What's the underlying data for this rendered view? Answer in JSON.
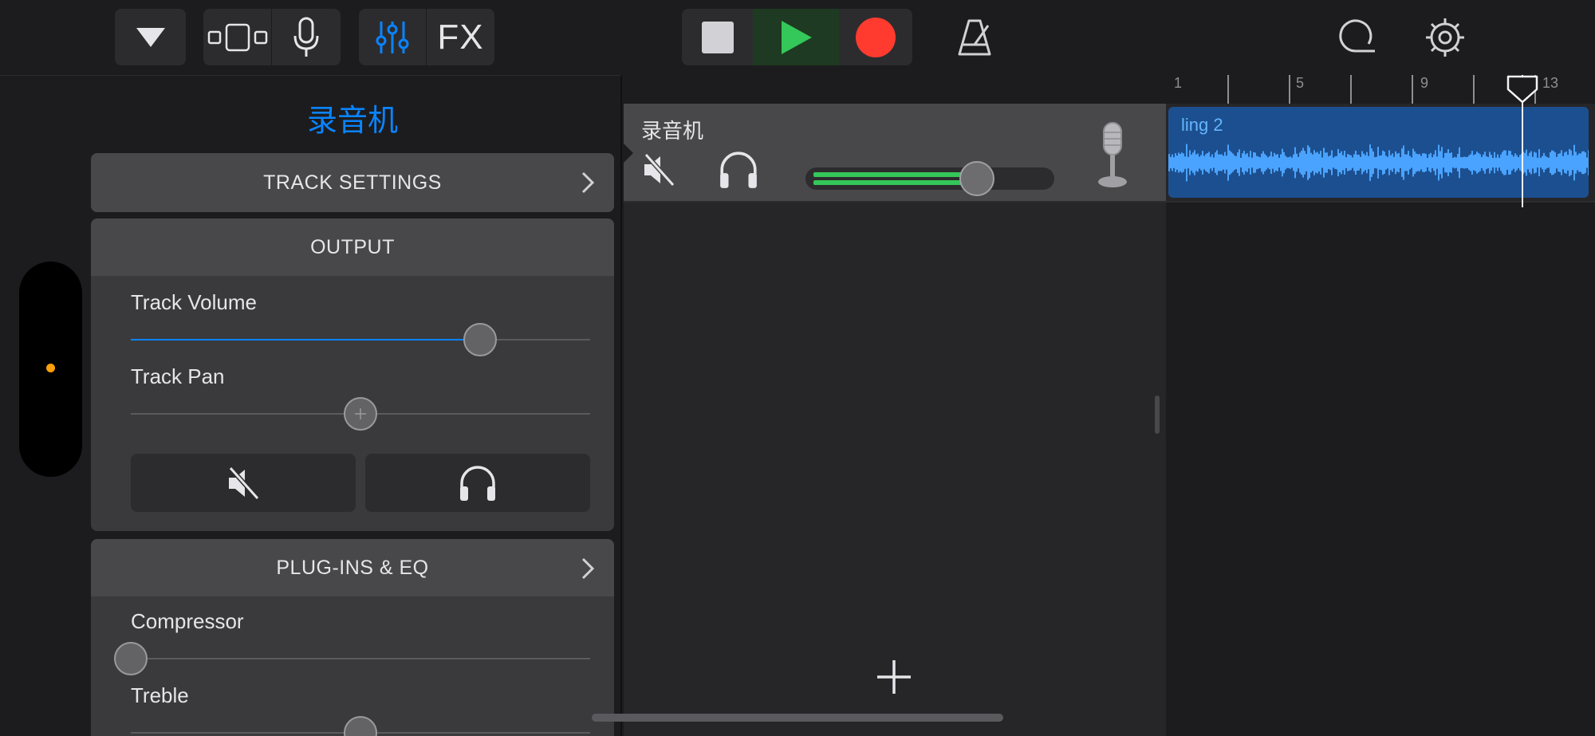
{
  "toolbar": {
    "browser_label": "",
    "fx_label": "FX"
  },
  "inspector": {
    "title": "录音机",
    "track_settings_label": "TRACK SETTINGS",
    "output": {
      "header": "OUTPUT",
      "volume_label": "Track Volume",
      "volume_value": 0.76,
      "pan_label": "Track Pan",
      "pan_value": 0.5
    },
    "plugins": {
      "header": "PLUG-INS & EQ",
      "compressor_label": "Compressor",
      "compressor_value": 0.0,
      "treble_label": "Treble",
      "treble_value": 0.5
    }
  },
  "track": {
    "name": "录音机",
    "volume_value": 0.72
  },
  "timeline": {
    "ruler_numbers": [
      "1",
      "5",
      "9",
      "13"
    ],
    "region_name": "ling 2"
  },
  "colors": {
    "accent": "#0a84ff",
    "play_green": "#34c759",
    "record_red": "#ff3b30",
    "region_blue": "#1c4f8f",
    "waveform": "#4aa3ff"
  }
}
